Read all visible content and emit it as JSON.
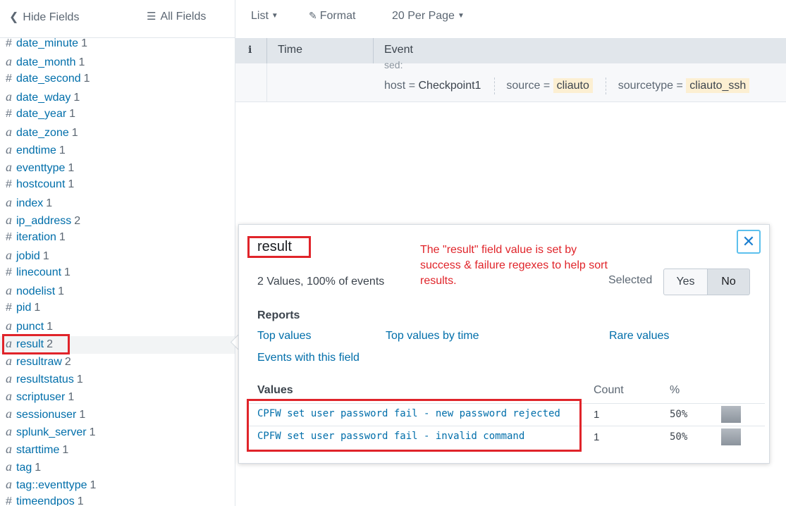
{
  "sidebar": {
    "hide_fields_label": "Hide Fields",
    "all_fields_label": "All Fields",
    "fields": [
      {
        "type": "#",
        "name": "date_minute",
        "count": "1"
      },
      {
        "type": "a",
        "name": "date_month",
        "count": "1"
      },
      {
        "type": "#",
        "name": "date_second",
        "count": "1"
      },
      {
        "type": "a",
        "name": "date_wday",
        "count": "1"
      },
      {
        "type": "#",
        "name": "date_year",
        "count": "1"
      },
      {
        "type": "a",
        "name": "date_zone",
        "count": "1"
      },
      {
        "type": "a",
        "name": "endtime",
        "count": "1"
      },
      {
        "type": "a",
        "name": "eventtype",
        "count": "1"
      },
      {
        "type": "#",
        "name": "hostcount",
        "count": "1"
      },
      {
        "type": "a",
        "name": "index",
        "count": "1"
      },
      {
        "type": "a",
        "name": "ip_address",
        "count": "2"
      },
      {
        "type": "#",
        "name": "iteration",
        "count": "1"
      },
      {
        "type": "a",
        "name": "jobid",
        "count": "1"
      },
      {
        "type": "#",
        "name": "linecount",
        "count": "1"
      },
      {
        "type": "a",
        "name": "nodelist",
        "count": "1"
      },
      {
        "type": "#",
        "name": "pid",
        "count": "1"
      },
      {
        "type": "a",
        "name": "punct",
        "count": "1"
      },
      {
        "type": "a",
        "name": "result",
        "count": "2",
        "active": true
      },
      {
        "type": "a",
        "name": "resultraw",
        "count": "2"
      },
      {
        "type": "a",
        "name": "resultstatus",
        "count": "1"
      },
      {
        "type": "a",
        "name": "scriptuser",
        "count": "1"
      },
      {
        "type": "a",
        "name": "sessionuser",
        "count": "1"
      },
      {
        "type": "a",
        "name": "splunk_server",
        "count": "1"
      },
      {
        "type": "a",
        "name": "starttime",
        "count": "1"
      },
      {
        "type": "a",
        "name": "tag",
        "count": "1"
      },
      {
        "type": "a",
        "name": "tag::eventtype",
        "count": "1"
      },
      {
        "type": "#",
        "name": "timeendpos",
        "count": "1"
      }
    ]
  },
  "toolbar": {
    "list_label": "List",
    "format_label": "Format",
    "per_page_label": "20 Per Page"
  },
  "table": {
    "info_header": "i",
    "time_header": "Time",
    "event_header": "Event",
    "cut_text": "sed:",
    "host_key": "host =",
    "host_value": "Checkpoint1",
    "source_key": "source =",
    "source_value": "cliauto",
    "sourcetype_key": "sourcetype =",
    "sourcetype_value": "cliauto_ssh"
  },
  "popover": {
    "title": "result",
    "stats": "2 Values, 100% of events",
    "annotation": "The \"result\" field value is set by success & failure regexes to help sort results.",
    "selected_label": "Selected",
    "yes_label": "Yes",
    "no_label": "No",
    "reports_title": "Reports",
    "reports": {
      "top_values": "Top values",
      "top_values_by_time": "Top values by time",
      "rare_values": "Rare values",
      "events_with_field": "Events with this field"
    },
    "values_title": "Values",
    "count_header": "Count",
    "pct_header": "%",
    "values": [
      {
        "value": "CPFW set user password fail - new password rejected",
        "count": "1",
        "pct": "50%"
      },
      {
        "value": "CPFW set user password fail - invalid command",
        "count": "1",
        "pct": "50%"
      }
    ]
  },
  "colors": {
    "link": "#006eaa",
    "annotation_red": "#e0242a",
    "highlight": "#fcefd2",
    "header_bg": "#e1e6eb"
  }
}
